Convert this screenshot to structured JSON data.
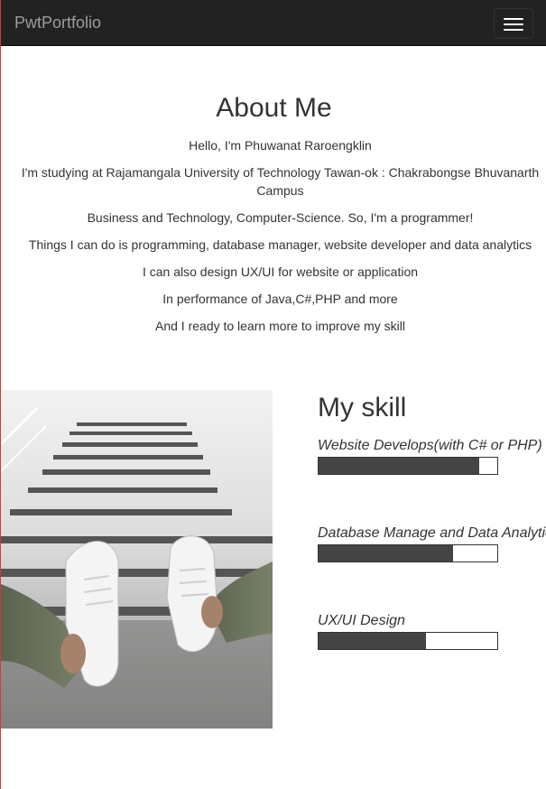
{
  "navbar": {
    "brand": "PwtPortfolio",
    "menu_icon": "hamburger-menu-icon"
  },
  "about": {
    "title": "About Me",
    "lines": [
      "Hello, I'm Phuwanat Raroengklin",
      "I'm studying at Rajamangala University of Technology Tawan-ok : Chakrabongse Bhuvanarth Campus",
      "Business and Technology, Computer-Science. So, I'm a programmer!",
      "Things I can do is programming, database manager, website developer and data analytics",
      "I can also design UX/UI for website or application",
      "In performance of Java,C#,PHP and more",
      "And I ready to learn more to improve my skill"
    ]
  },
  "photo": {
    "description_icon": "sneakers-on-stairs-photo"
  },
  "skills": {
    "title": "My skill",
    "items": [
      {
        "label": "Website Develops(with C# or PHP)",
        "level": 0.9
      },
      {
        "label": "Database Manage and Data Analytics",
        "level": 0.75
      },
      {
        "label": "UX/UI Design",
        "level": 0.6
      }
    ]
  },
  "colors": {
    "navbar_bg": "#222222",
    "brand_text": "#9d9d9d",
    "bar_fill": "#444444",
    "page_border": "#d9363e"
  }
}
